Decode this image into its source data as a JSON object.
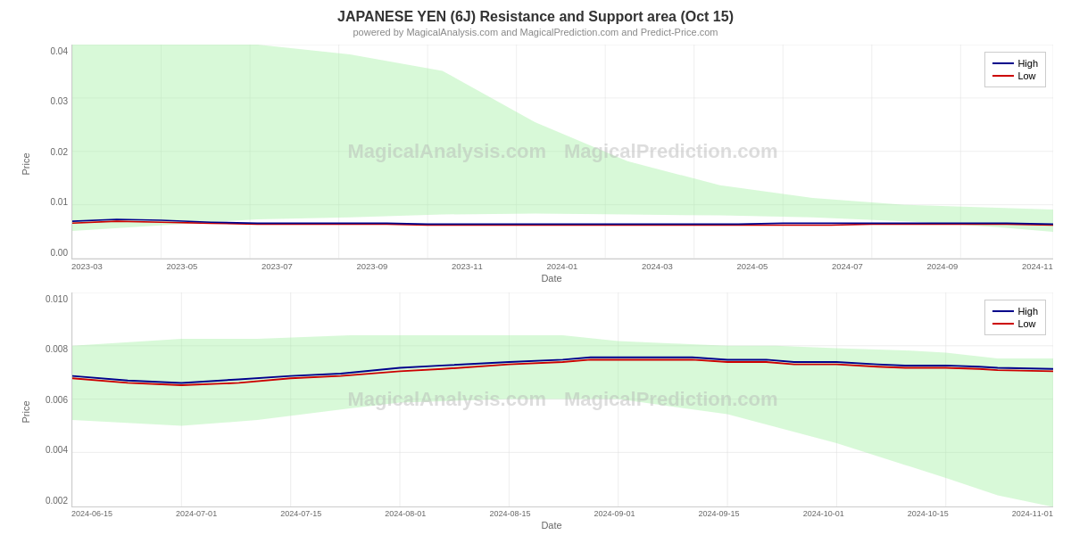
{
  "title": "JAPANESE YEN (6J) Resistance and Support area (Oct 15)",
  "subtitle": "powered by MagicalAnalysis.com and MagicalPrediction.com and Predict-Price.com",
  "chart1": {
    "y_label": "Price",
    "x_label": "Date",
    "y_ticks": [
      "0.04",
      "0.03",
      "0.02",
      "0.01",
      "0.00"
    ],
    "x_ticks": [
      "2023-03",
      "2023-05",
      "2023-07",
      "2023-09",
      "2023-11",
      "2024-01",
      "2024-03",
      "2024-05",
      "2024-07",
      "2024-09",
      "2024-11"
    ],
    "legend": {
      "high_label": "High",
      "low_label": "Low",
      "high_color": "#00008B",
      "low_color": "#CC0000"
    },
    "watermarks": [
      "MagicalAnalysis.com",
      "MagicalPrediction.com"
    ]
  },
  "chart2": {
    "y_label": "Price",
    "x_label": "Date",
    "y_ticks": [
      "0.010",
      "0.008",
      "0.006",
      "0.004",
      "0.002"
    ],
    "x_ticks": [
      "2024-06-15",
      "2024-07-01",
      "2024-07-15",
      "2024-08-01",
      "2024-08-15",
      "2024-09-01",
      "2024-09-15",
      "2024-10-01",
      "2024-10-15",
      "2024-11-01"
    ],
    "legend": {
      "high_label": "High",
      "low_label": "Low",
      "high_color": "#00008B",
      "low_color": "#CC0000"
    },
    "watermarks": [
      "MagicalAnalysis.com",
      "MagicalPrediction.com"
    ]
  }
}
